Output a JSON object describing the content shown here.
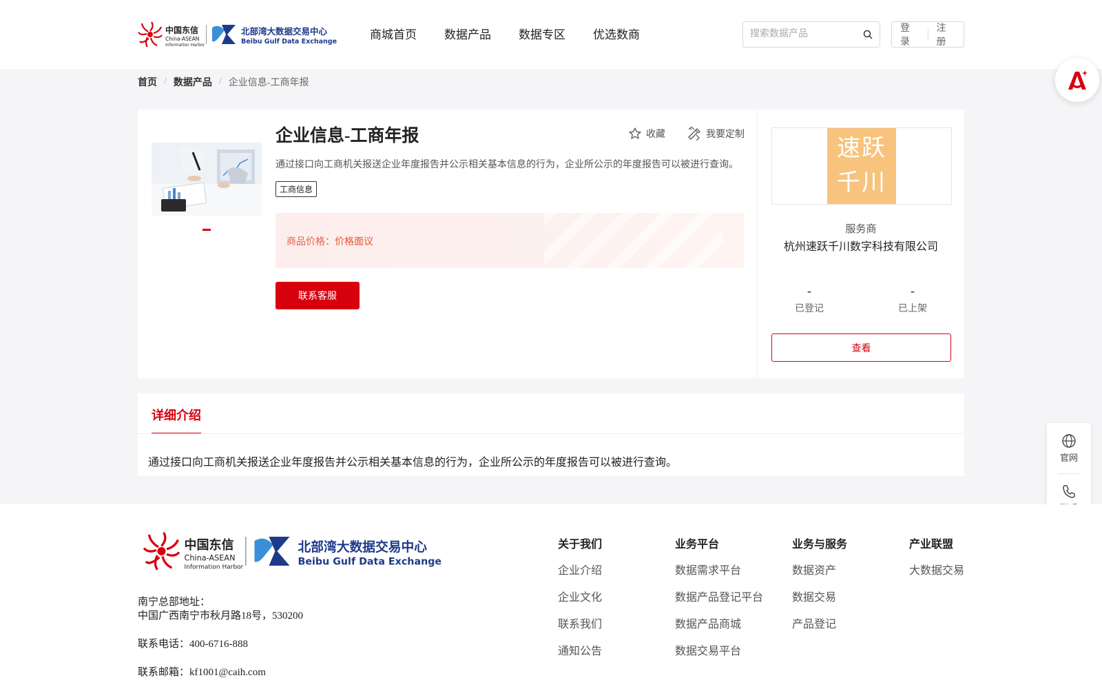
{
  "header": {
    "logo_alt": "中国东信 China-ASEAN Information Harbor | 北部湾大数据交易中心 Beibu Gulf Data Exchange",
    "nav": [
      "商城首页",
      "数据产品",
      "数据专区",
      "优选数商"
    ],
    "search_placeholder": "搜索数据产品",
    "login": "登录",
    "register": "注册"
  },
  "logo_text": {
    "cn_brand": "中国东信",
    "en_brand_1": "China-ASEAN",
    "en_brand_2": "Information Harbor",
    "exchange_cn": "北部湾大数据交易中心",
    "exchange_en": "Beibu Gulf Data Exchange"
  },
  "breadcrumb": {
    "home": "首页",
    "products": "数据产品",
    "current": "企业信息-工商年报",
    "separator": "/"
  },
  "product": {
    "title": "企业信息-工商年报",
    "favorite": "收藏",
    "customize": "我要定制",
    "description": "通过接口向工商机关报送企业年度报告并公示相关基本信息的行为，企业所公示的年度报告可以被进行查询。",
    "tag": "工商信息",
    "price_label": "商品价格：",
    "price_value": "价格面议",
    "contact_button": "联系客服"
  },
  "provider": {
    "logo_line1": "速跃",
    "logo_line2": "千川",
    "label": "服务商",
    "name": "杭州速跃千川数字科技有限公司",
    "stats": [
      {
        "value": "-",
        "label": "已登记"
      },
      {
        "value": "-",
        "label": "已上架"
      }
    ],
    "view_button": "查看"
  },
  "detail": {
    "tab": "详细介绍",
    "text": "通过接口向工商机关报送企业年度报告并公示相关基本信息的行为，企业所公示的年度报告可以被进行查询。"
  },
  "float": {
    "official": "官网",
    "contact": "联系"
  },
  "footer": {
    "address_label": "南宁总部地址：",
    "address": "中国广西南宁市秋月路18号，530200",
    "phone": "联系电话：400-6716-888",
    "email": "联系邮箱：kf1001@caih.com",
    "columns": [
      {
        "title": "关于我们",
        "links": [
          "企业介绍",
          "企业文化",
          "联系我们",
          "通知公告"
        ]
      },
      {
        "title": "业务平台",
        "links": [
          "数据需求平台",
          "数据产品登记平台",
          "数据产品商城",
          "数据交易平台"
        ]
      },
      {
        "title": "业务与服务",
        "links": [
          "数据资产",
          "数据交易",
          "产品登记"
        ]
      },
      {
        "title": "产业联盟",
        "links": [
          "大数据交易"
        ]
      }
    ]
  },
  "colors": {
    "brand_red": "#d7000f",
    "price_orange": "#e8614d",
    "exchange_blue": "#1e3a8a",
    "provider_logo_bg": "#f8c37d"
  },
  "icons": [
    "search-icon",
    "star-icon",
    "customize-icon",
    "globe-icon",
    "phone-icon",
    "ai-assistant-icon"
  ]
}
